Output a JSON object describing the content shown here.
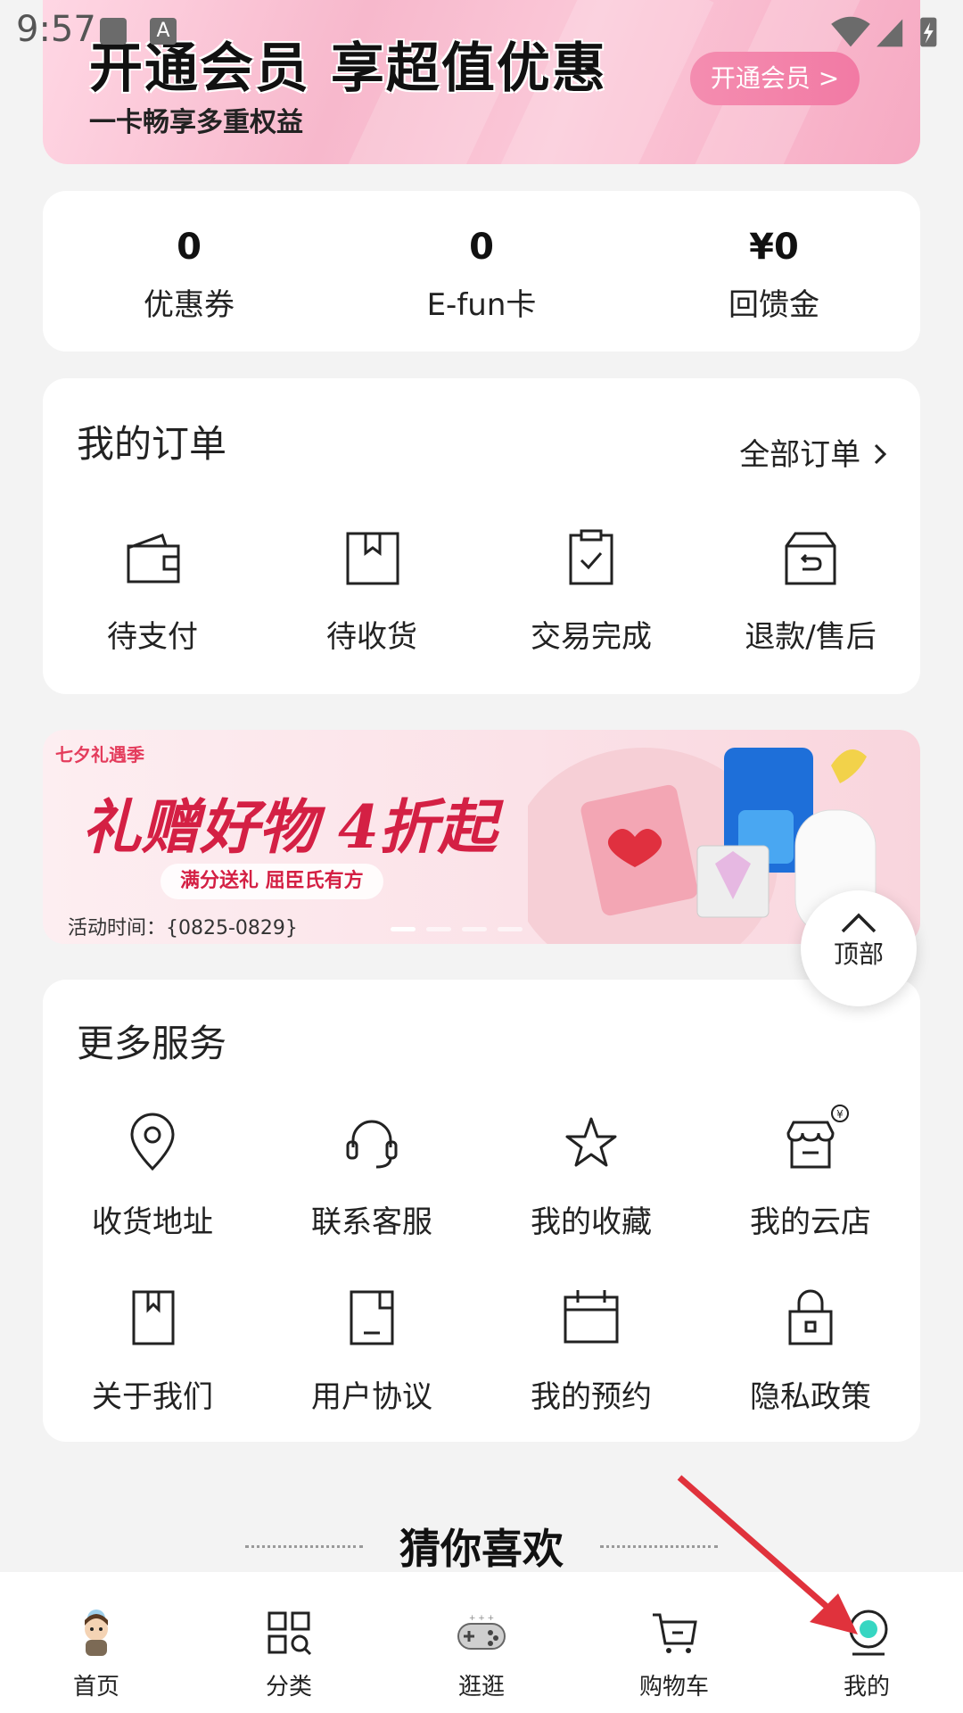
{
  "status": {
    "time": "9:57",
    "indicator": "A"
  },
  "vip": {
    "title": "开通会员 享超值优惠",
    "subtitle": "一卡畅享多重权益",
    "button": "开通会员 >"
  },
  "stats": [
    {
      "value": "0",
      "label": "优惠券"
    },
    {
      "value": "0",
      "label": "E-fun卡"
    },
    {
      "value": "¥0",
      "label": "回馈金"
    }
  ],
  "orders": {
    "title": "我的订单",
    "all_label": "全部订单",
    "items": [
      {
        "label": "待支付",
        "icon": "wallet-icon"
      },
      {
        "label": "待收货",
        "icon": "package-icon"
      },
      {
        "label": "交易完成",
        "icon": "clipboard-check-icon"
      },
      {
        "label": "退款/售后",
        "icon": "return-box-icon"
      }
    ]
  },
  "promo": {
    "tag": "七夕礼遇季",
    "headline": "礼赠好物 4折起",
    "subline": "满分送礼 屈臣氏有方",
    "date": "活动时间：{0825-0829}"
  },
  "back_to_top": {
    "label": "顶部"
  },
  "services": {
    "title": "更多服务",
    "items": [
      {
        "label": "收货地址",
        "icon": "location-pin-icon"
      },
      {
        "label": "联系客服",
        "icon": "headset-icon"
      },
      {
        "label": "我的收藏",
        "icon": "star-icon"
      },
      {
        "label": "我的云店",
        "icon": "store-icon"
      },
      {
        "label": "关于我们",
        "icon": "bookmark-icon"
      },
      {
        "label": "用户协议",
        "icon": "document-icon"
      },
      {
        "label": "我的预约",
        "icon": "calendar-icon"
      },
      {
        "label": "隐私政策",
        "icon": "lock-icon"
      }
    ]
  },
  "recommend": {
    "title": "猜你喜欢"
  },
  "nav": {
    "items": [
      {
        "label": "首页",
        "icon": "home-mascot-icon"
      },
      {
        "label": "分类",
        "icon": "category-grid-icon"
      },
      {
        "label": "逛逛",
        "icon": "gamepad-icon"
      },
      {
        "label": "购物车",
        "icon": "cart-icon"
      },
      {
        "label": "我的",
        "icon": "profile-icon",
        "active": true
      }
    ]
  },
  "colors": {
    "accent": "#d42044",
    "vip_pink": "#f48db0",
    "annotation_arrow": "#e0323c"
  }
}
